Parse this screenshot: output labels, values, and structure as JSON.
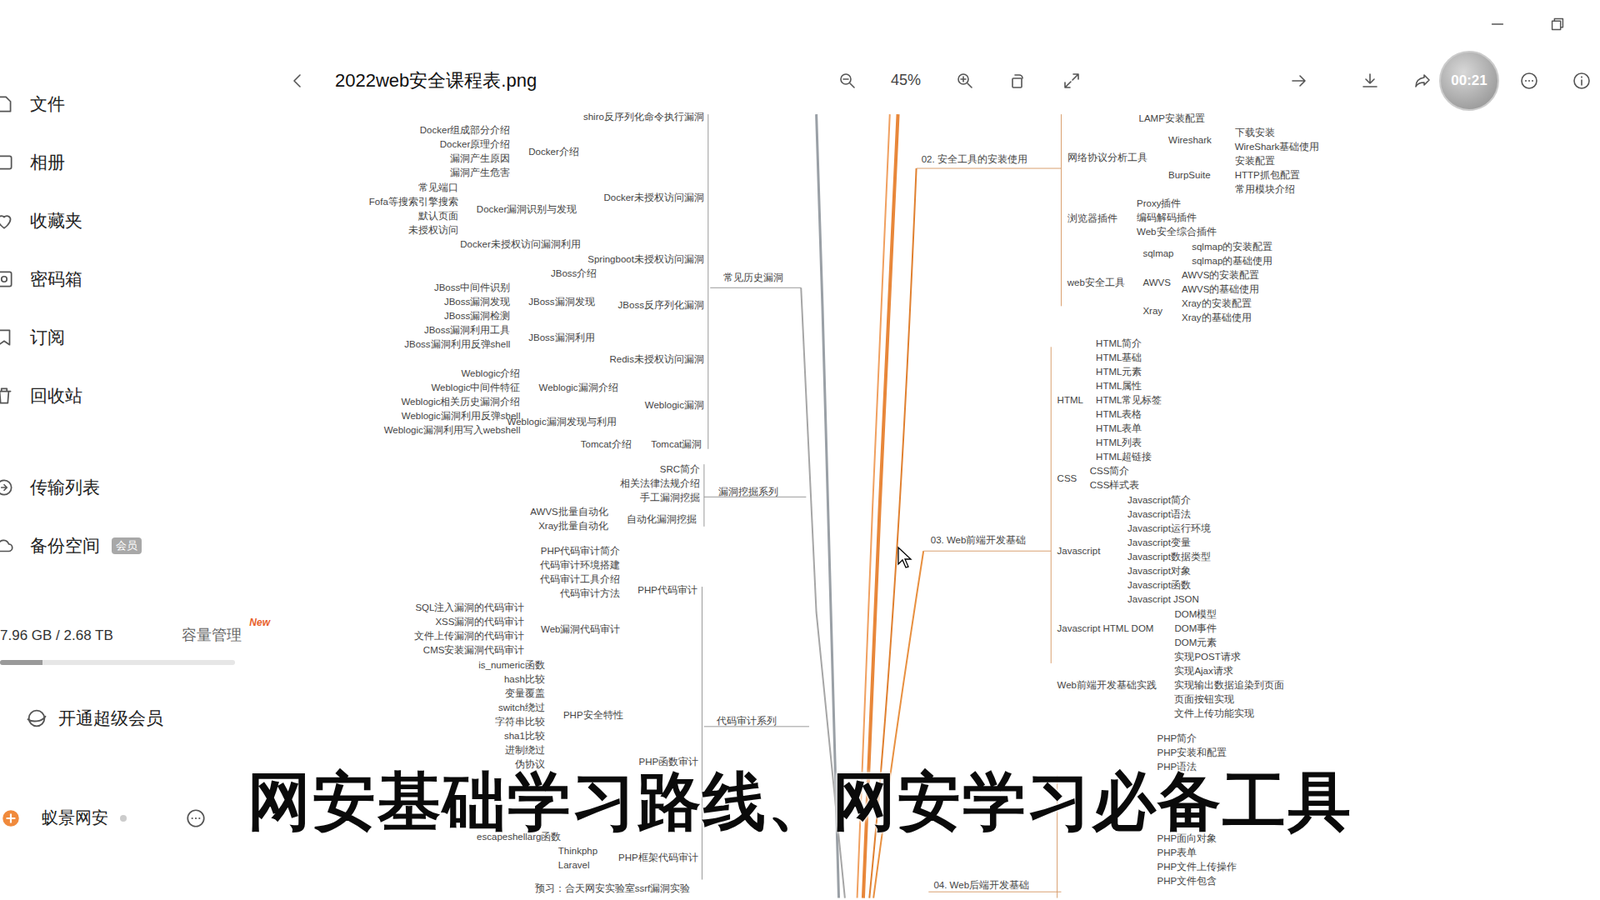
{
  "viewer": {
    "title": "2022web安全课程表.png",
    "zoom": "45%",
    "timer": "00:21"
  },
  "sidebar": {
    "items": [
      {
        "label": "文件"
      },
      {
        "label": "相册"
      },
      {
        "label": "收藏夹"
      },
      {
        "label": "密码箱"
      },
      {
        "label": "订阅"
      },
      {
        "label": "回收站"
      },
      {
        "label": "传输列表"
      },
      {
        "label": "备份空间",
        "badge": "会员"
      }
    ],
    "storage": {
      "text": "7.96 GB / 2.68 TB",
      "level": 0.18,
      "manage": "容量管理",
      "manage_badge": "New"
    },
    "vip": "开通超级会员",
    "user": "蚁景网安"
  },
  "mindmap": {
    "groups": [
      {
        "items": [
          "shiro反序列化命令执行漏洞"
        ]
      },
      {
        "items": [
          "Docker组成部分介绍",
          "Docker原理介绍",
          "漏洞产生原因",
          "漏洞产生危害"
        ]
      },
      {
        "items": [
          "Docker介绍"
        ]
      },
      {
        "items": [
          "常见端口",
          "Fofa等搜索引擎搜索",
          "默认页面",
          "未授权访问"
        ]
      },
      {
        "items": [
          "Docker漏洞识别与发现"
        ]
      },
      {
        "items": [
          "Docker未授权访问漏洞"
        ]
      },
      {
        "items": [
          "Docker未授权访问漏洞利用"
        ]
      },
      {
        "items": [
          "Springboot未授权访问漏洞"
        ]
      },
      {
        "items": [
          "JBoss介绍"
        ]
      },
      {
        "items": [
          "常见历史漏洞"
        ]
      },
      {
        "items": [
          "JBoss中间件识别",
          "JBoss漏洞发现",
          "JBoss漏洞检测",
          "JBoss漏洞利用工具",
          "JBoss漏洞利用反弹shell"
        ]
      },
      {
        "items": [
          "JBoss漏洞发现"
        ]
      },
      {
        "items": [
          "JBoss反序列化漏洞"
        ]
      },
      {
        "items": [
          "JBoss漏洞利用"
        ]
      },
      {
        "items": [
          "Redis未授权访问漏洞"
        ]
      },
      {
        "items": [
          "Weblogic介绍",
          "Weblogic中间件特征",
          "Weblogic相关历史漏洞介绍",
          "Weblogic漏洞利用反弹shell",
          "Weblogic漏洞利用写入webshell"
        ]
      },
      {
        "items": [
          "Weblogic漏洞介绍"
        ]
      },
      {
        "items": [
          "Weblogic漏洞"
        ]
      },
      {
        "items": [
          "Weblogic漏洞发现与利用"
        ]
      },
      {
        "items": [
          "Tomcat介绍"
        ]
      },
      {
        "items": [
          "Tomcat漏洞"
        ]
      },
      {
        "items": [
          "SRC简介",
          "相关法律法规介绍",
          "手工漏洞挖掘"
        ]
      },
      {
        "items": [
          "漏洞挖掘系列"
        ]
      },
      {
        "items": [
          "AWVS批量自动化",
          "Xray批量自动化"
        ]
      },
      {
        "items": [
          "自动化漏洞挖掘"
        ]
      },
      {
        "items": [
          "PHP代码审计简介",
          "代码审计环境搭建",
          "代码审计工具介绍",
          "代码审计方法"
        ]
      },
      {
        "items": [
          "PHP代码审计"
        ]
      },
      {
        "items": [
          "SQL注入漏洞的代码审计",
          "XSS漏洞的代码审计",
          "文件上传漏洞的代码审计",
          "CMS安装漏洞代码审计"
        ]
      },
      {
        "items": [
          "Web漏洞代码审计"
        ]
      },
      {
        "items": [
          "is_numeric函数",
          "hash比较",
          "变量覆盖",
          "switch绕过",
          "字符串比较",
          "sha1比较",
          "进制绕过",
          "伪协议"
        ]
      },
      {
        "items": [
          "PHP安全特性"
        ]
      },
      {
        "items": [
          "代码审计系列"
        ]
      },
      {
        "items": [
          "PHP函数审计"
        ]
      },
      {
        "items": [
          "escapeshellarg函数"
        ]
      },
      {
        "items": [
          "Thinkphp",
          "Laravel"
        ]
      },
      {
        "items": [
          "PHP框架代码审计"
        ]
      },
      {
        "items": [
          "预习：合天网安实验室ssrf漏洞实验"
        ]
      },
      {
        "items": [
          "LAMP安装配置"
        ]
      },
      {
        "items": [
          "Wireshark"
        ]
      },
      {
        "items": [
          "下载安装",
          "WireShark基础使用",
          "安装配置",
          "HTTP抓包配置",
          "常用模块介绍"
        ]
      },
      {
        "items": [
          "网络协议分析工具"
        ]
      },
      {
        "items": [
          "02. 安全工具的安装使用"
        ]
      },
      {
        "items": [
          "BurpSuite"
        ]
      },
      {
        "items": [
          "Proxy插件",
          "编码解码插件",
          "Web安全综合插件"
        ]
      },
      {
        "items": [
          "浏览器插件"
        ]
      },
      {
        "items": [
          "sqlmap的安装配置",
          "sqlmap的基础使用"
        ]
      },
      {
        "items": [
          "sqlmap"
        ]
      },
      {
        "items": [
          "AWVS的安装配置",
          "AWVS的基础使用"
        ]
      },
      {
        "items": [
          "web安全工具"
        ]
      },
      {
        "items": [
          "AWVS"
        ]
      },
      {
        "items": [
          "Xray的安装配置",
          "Xray的基础使用"
        ]
      },
      {
        "items": [
          "Xray"
        ]
      },
      {
        "items": [
          "HTML简介",
          "HTML基础",
          "HTML元素",
          "HTML属性",
          "HTML常见标签",
          "HTML表格",
          "HTML表单",
          "HTML列表",
          "HTML超链接"
        ]
      },
      {
        "items": [
          "HTML"
        ]
      },
      {
        "items": [
          "CSS简介",
          "CSS样式表"
        ]
      },
      {
        "items": [
          "CSS"
        ]
      },
      {
        "items": [
          "Javascript简介",
          "Javascript语法",
          "Javascript运行环境",
          "Javascript变量",
          "Javascript数据类型",
          "Javascript对象",
          "Javascript函数",
          "Javascript JSON"
        ]
      },
      {
        "items": [
          "03. Web前端开发基础"
        ]
      },
      {
        "items": [
          "Javascript"
        ]
      },
      {
        "items": [
          "DOM模型",
          "DOM事件",
          "DOM元素"
        ]
      },
      {
        "items": [
          "Javascript HTML DOM"
        ]
      },
      {
        "items": [
          "实现POST请求",
          "实现Ajax请求",
          "实现输出数据追染到页面",
          "页面按钮实现",
          "文件上传功能实现"
        ]
      },
      {
        "items": [
          "Web前端开发基础实践"
        ]
      },
      {
        "items": [
          "PHP简介",
          "PHP安装和配置",
          "PHP语法"
        ]
      },
      {
        "items": [
          "PHP面向对象",
          "PHP表单",
          "PHP文件上传操作",
          "PHP文件包含"
        ]
      },
      {
        "items": [
          "04. Web后端开发基础"
        ]
      }
    ]
  },
  "subtitle": "网安基础学习路线、网安学习必备工具"
}
